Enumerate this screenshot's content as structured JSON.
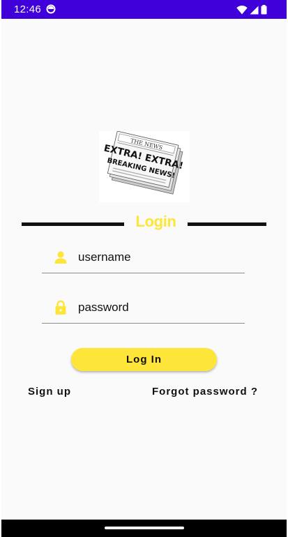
{
  "status_bar": {
    "time": "12:46",
    "background": "#3f00d9",
    "icons": [
      "sync-icon",
      "wifi-icon",
      "signal-icon",
      "battery-icon"
    ]
  },
  "logo": {
    "header_text": "THE NEWS",
    "headline_1": "EXTRA! EXTRA!",
    "headline_2": "BREAKING NEWS!"
  },
  "login_form": {
    "title": "Login",
    "username": {
      "placeholder": "username",
      "value": "",
      "icon": "person-icon"
    },
    "password": {
      "placeholder": "password",
      "value": "",
      "icon": "lock-icon"
    },
    "login_button_label": "Log In"
  },
  "links": {
    "sign_up": "Sign up",
    "forgot_password": "Forgot password ?"
  },
  "colors": {
    "accent": "#fde53a",
    "divider": "#111111",
    "background": "#fafafa"
  }
}
